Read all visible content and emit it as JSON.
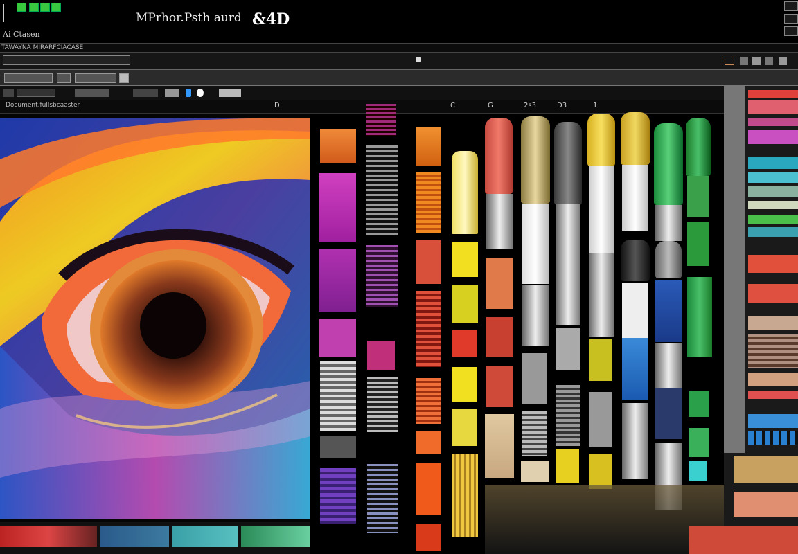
{
  "window": {
    "title": "MPrhor.Psth aurd",
    "logo": "&4D",
    "subtitle": "Ai Ctasen"
  },
  "menubar": {
    "text": "TAWAYNA MIRARFCIACASE"
  },
  "document": {
    "tab_label": "Document.fullsbcaaster",
    "column_labels": [
      "D",
      "C",
      "G",
      "2s3",
      "D3",
      "1"
    ]
  },
  "colors": {
    "accent_green": "#39c93f",
    "panel_bg": "#1a1a1a",
    "canvas_blue": "#2a3a8a"
  },
  "icons": [
    "green-square-icon",
    "close-icon",
    "maximize-icon",
    "minimize-icon",
    "paint-brush-icon",
    "eye-artwork"
  ]
}
